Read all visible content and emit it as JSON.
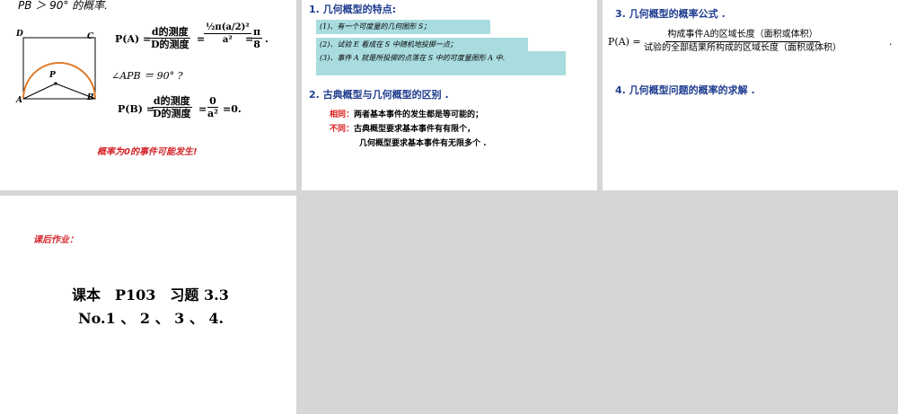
{
  "slide1": {
    "top_text": "PB ＞ 90° 的概率.",
    "labels": {
      "D": "D",
      "C": "C",
      "A": "A",
      "B": "B",
      "P": "P"
    },
    "pa_left": "P(A) =",
    "pa_frac_num": "d的测度",
    "pa_frac_den": "D的测度",
    "pa_eq": "=",
    "pa_mid_num": "½π(a/2)²",
    "pa_mid_den": "a²",
    "pa_eq2": "=",
    "pa_res_num": "π",
    "pa_res_den": "8",
    "pa_end": ".",
    "angle_text": "∠APB ＝ 90° ?",
    "pb_left": "P(B) =",
    "pb_frac_num": "d的测度",
    "pb_frac_den": "D的测度",
    "pb_eq": "=",
    "pb_mid_num": "0",
    "pb_mid_den": "a²",
    "pb_end": "=0.",
    "note": "概率为0的事件可能发生!"
  },
  "slide2": {
    "h1": "1. 几何概型的特点:",
    "box1": "(1)、有一个可度量的几何图形 S；",
    "box2": "(2)、试验 E 看成在 S 中随机地投掷一点；",
    "box3": "(3)、事件 A 就是所投掷的点落在 S 中的可度量图形 A 中.",
    "h2": "2. 古典概型与几何概型的区别 .",
    "same_label": "相同：",
    "same_text": "两者基本事件的发生都是等可能的；",
    "diff_label": "不同：",
    "diff_text1": "古典概型要求基本事件有有限个，",
    "diff_text2": "几何概型要求基本事件有无限多个 ."
  },
  "slide3": {
    "h3": "3. 几何概型的概率公式 .",
    "formula_left": "P(A) =",
    "formula_num": "构成事件A的区域长度（面积或体积）",
    "formula_den": "试验的全部结果所构成的区域长度（面积或体积）",
    "formula_end": ".",
    "h4": "4. 几何概型问题的概率的求解 ."
  },
  "slide4": {
    "homework_title": "课后作业：",
    "line1": "课本　P103　习题 3.3",
    "line2": "No.1 、 2 、 3 、 4."
  },
  "colors": {
    "heading_blue": "#1f3c8f",
    "box_teal": "#a9dcdf",
    "red": "#d91a1a",
    "arc_orange": "#e07a2a",
    "background": "#d6d6d6"
  }
}
